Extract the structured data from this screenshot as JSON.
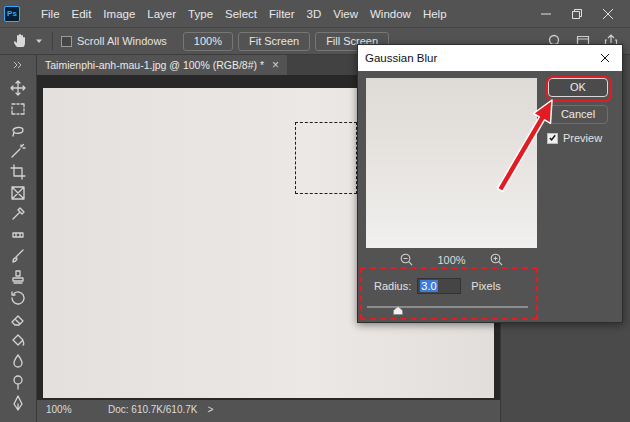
{
  "logo": "Ps",
  "menu": [
    "File",
    "Edit",
    "Image",
    "Layer",
    "Type",
    "Select",
    "Filter",
    "3D",
    "View",
    "Window",
    "Help"
  ],
  "options_bar": {
    "scroll_all_windows": {
      "label": "Scroll All Windows",
      "checked": false
    },
    "buttons": [
      "100%",
      "Fit Screen",
      "Fill Screen"
    ]
  },
  "document_tab": {
    "title": "Taimienphi-anh-mau-1.jpg @ 100% (RGB/8#) *",
    "close": "×"
  },
  "canvas": {
    "selection_visible": true
  },
  "status_bar": {
    "zoom": "100%",
    "doc": "Doc: 610.7K/610.7K",
    "more": ">"
  },
  "dialog": {
    "title": "Gaussian Blur",
    "zoom": "100%",
    "buttons": [
      {
        "label": "OK",
        "selected": true
      },
      {
        "label": "Cancel",
        "selected": false
      }
    ],
    "preview": {
      "label": "Preview",
      "checked": true
    },
    "radius": {
      "label": "Radius:",
      "value": "3.0",
      "value_selected": true,
      "unit": "Pixels",
      "level": 0.19
    }
  }
}
